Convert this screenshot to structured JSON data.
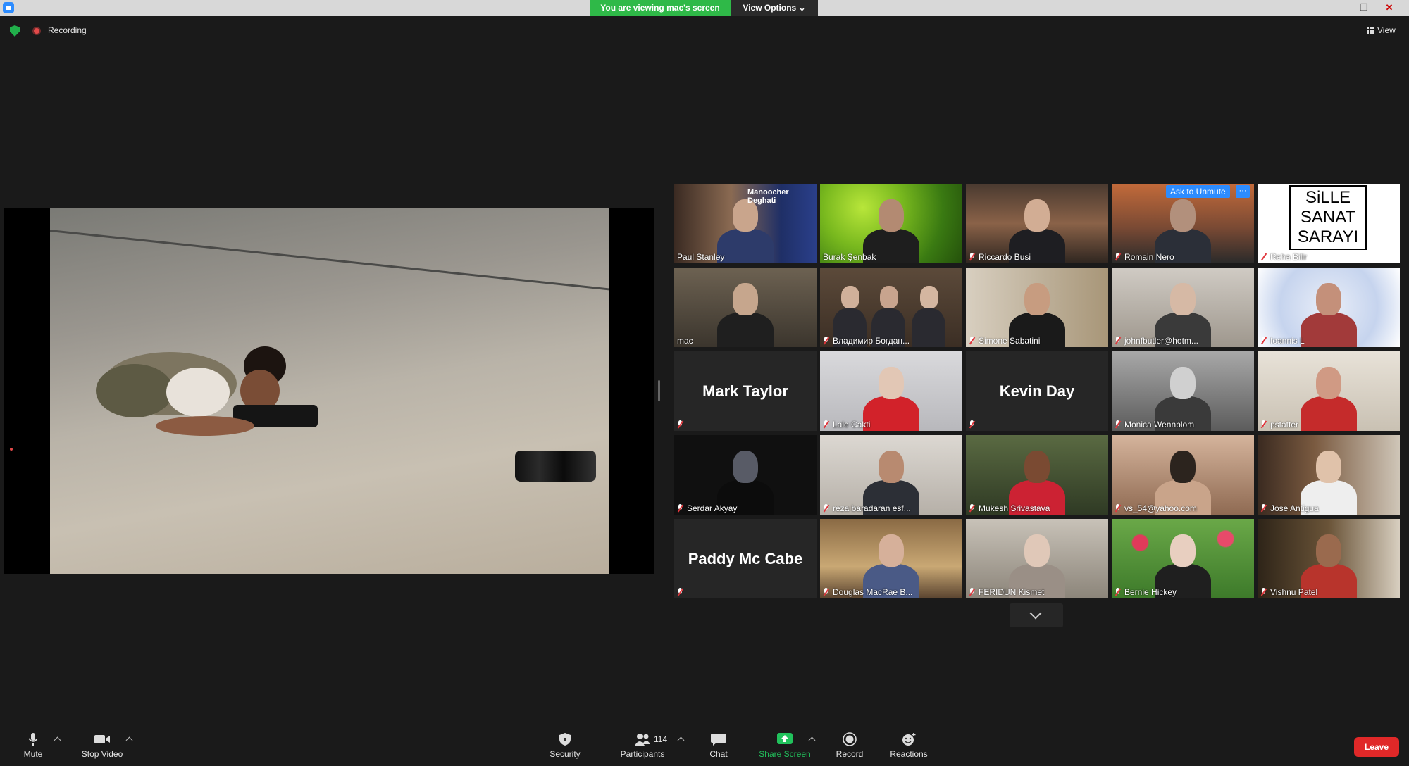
{
  "titlebar": {
    "banner": "You are viewing mac's screen",
    "view_options": "View Options ⌄",
    "min": "–",
    "max": "❐",
    "close": "✕"
  },
  "status": {
    "recording": "Recording",
    "view": "View"
  },
  "ask_to_unmute": "Ask to Unmute",
  "ask_more": "···",
  "participants": [
    {
      "name": "Paul Stanley",
      "display": "video"
    },
    {
      "name": "Burak Şenbak",
      "display": "video"
    },
    {
      "name": "Riccardo Busi",
      "display": "video"
    },
    {
      "name": "Romain Nero",
      "display": "video"
    },
    {
      "name": "Reha Bilir",
      "display": "video"
    },
    {
      "name": "mac",
      "display": "video",
      "active": true
    },
    {
      "name": "Владимир Богдан...",
      "display": "video"
    },
    {
      "name": "Simone Sabatini",
      "display": "video"
    },
    {
      "name": "johnfbutler@hotm...",
      "display": "video"
    },
    {
      "name": "Ioannis L",
      "display": "video"
    },
    {
      "name": "Mark Taylor",
      "display": "name"
    },
    {
      "name": "Lale Cakti",
      "display": "video"
    },
    {
      "name": "Kevin Day",
      "display": "name"
    },
    {
      "name": "Monica Wennblom",
      "display": "video"
    },
    {
      "name": "pstatter",
      "display": "video"
    },
    {
      "name": "Serdar Akyay",
      "display": "video"
    },
    {
      "name": "reza baradaran esf...",
      "display": "video"
    },
    {
      "name": "Mukesh Srivastava",
      "display": "video"
    },
    {
      "name": "vs_54@yahoo.com",
      "display": "video"
    },
    {
      "name": "Jose Antigua",
      "display": "video"
    },
    {
      "name": "Paddy Mc Cabe",
      "display": "name"
    },
    {
      "name": "Douglas MacRae B...",
      "display": "video"
    },
    {
      "name": "FERIDUN Kismet",
      "display": "video"
    },
    {
      "name": "Bernie Hickey",
      "display": "video"
    },
    {
      "name": "Vishnu Patel",
      "display": "video"
    }
  ],
  "tile_text": {
    "paul_stanley_banner": "Manoocher Deghati",
    "reha_logo_line1": "SiLLE",
    "reha_logo_line2": "SANAT",
    "reha_logo_line3": "SARAYI"
  },
  "toolbar": {
    "mute": "Mute",
    "stop_video": "Stop Video",
    "security": "Security",
    "participants": "Participants",
    "participants_count": "114",
    "chat": "Chat",
    "share_screen": "Share Screen",
    "record": "Record",
    "reactions": "Reactions",
    "leave": "Leave"
  },
  "colors": {
    "banner_green": "#2fb948",
    "accent_blue": "#2d8cff",
    "leave_red": "#e02828",
    "active_speaker": "#e6d34a",
    "share_green": "#21c25c"
  }
}
